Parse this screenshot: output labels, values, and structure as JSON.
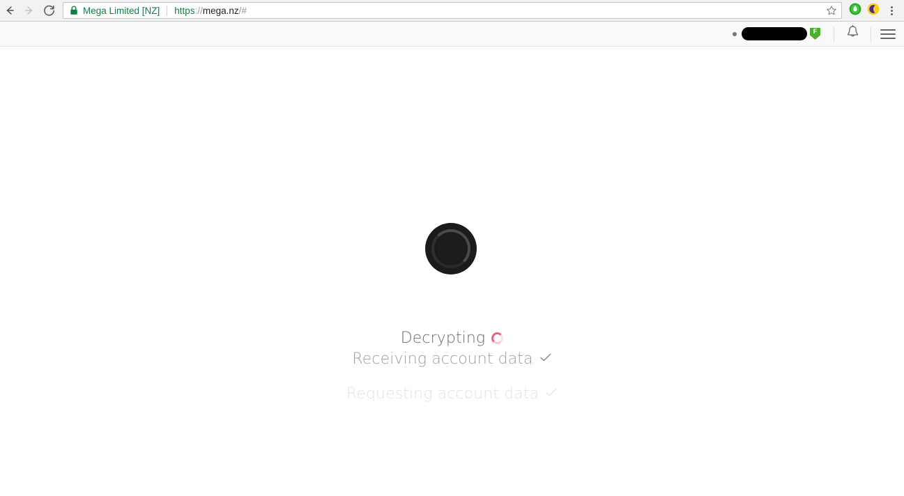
{
  "browser": {
    "back_icon": "back-arrow-icon",
    "forward_icon": "forward-arrow-icon",
    "reload_icon": "reload-icon",
    "lock_icon": "lock-icon",
    "site_identity": "Mega Limited [NZ]",
    "url": {
      "scheme": "https",
      "separator": "://",
      "host": "mega.nz",
      "path": "/#",
      "full": "https://mega.nz/#"
    },
    "star_icon": "bookmark-star-icon",
    "extensions": [
      {
        "name": "extension-green-icon",
        "color": "#3cb54a"
      },
      {
        "name": "extension-moon-icon",
        "color": "#f7d117"
      }
    ],
    "menu_icon": "chrome-menu-icon"
  },
  "page_header": {
    "presence_dot": "presence-indicator",
    "account_name_redacted": "",
    "password_badge_letter": "F",
    "password_badge_color": "#4caf2f",
    "notifications_icon": "bell-icon",
    "menu_icon": "hamburger-menu-icon"
  },
  "loading": {
    "spinner_icon": "page-loading-spinner",
    "statuses": [
      {
        "label": "Decrypting",
        "state": "active",
        "indicator": "ring-spinner-icon"
      },
      {
        "label": "Receiving account data",
        "state": "done",
        "indicator": "check-icon"
      },
      {
        "label": "Requesting account data",
        "state": "faded",
        "indicator": "check-icon"
      }
    ]
  },
  "colors": {
    "accent_red": "#f4607a",
    "identity_green": "#0b8043",
    "page_background": "#ffffff",
    "header_background": "#f9f9f9"
  }
}
